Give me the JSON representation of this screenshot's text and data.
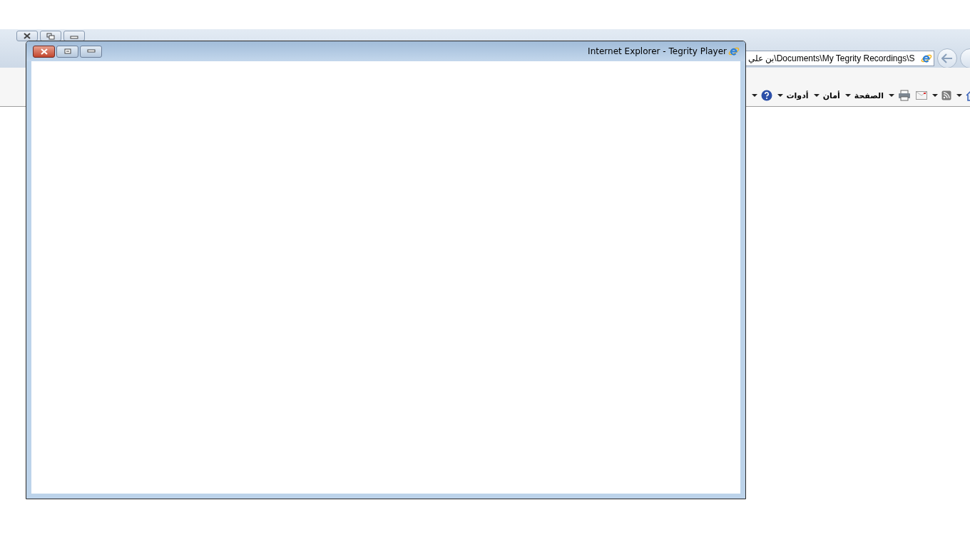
{
  "browser": {
    "address_bar": {
      "value": "بن علي\\Documents\\My Tegrity Recordings\\S"
    },
    "command_bar": [
      {
        "kind": "home",
        "dropdown": true
      },
      {
        "kind": "feeds",
        "dropdown": true
      },
      {
        "kind": "mail",
        "dropdown": false
      },
      {
        "kind": "print",
        "dropdown": true
      },
      {
        "kind": "menu",
        "label": "الصفحة",
        "dropdown": true
      },
      {
        "kind": "menu",
        "label": "أمان",
        "dropdown": true
      },
      {
        "kind": "menu",
        "label": "أدوات",
        "dropdown": true
      },
      {
        "kind": "help",
        "dropdown": true
      }
    ]
  },
  "popup_window": {
    "title": "Internet Explorer - Tegrity Player"
  }
}
